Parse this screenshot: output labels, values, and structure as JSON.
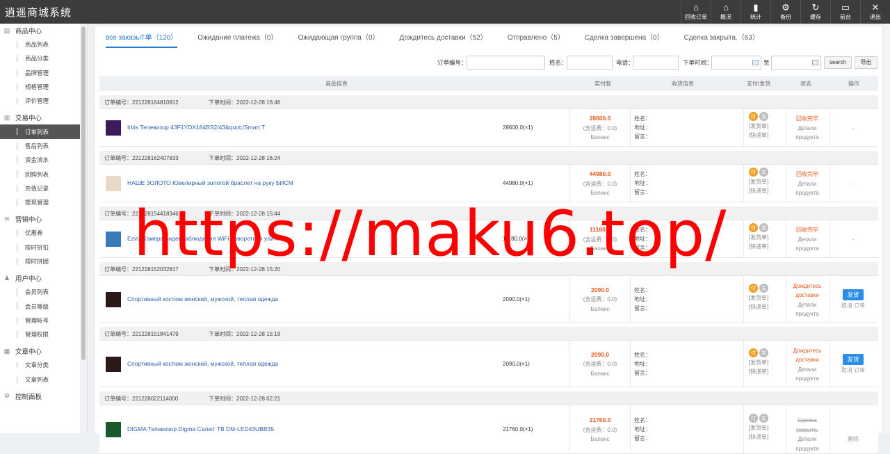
{
  "app": {
    "title": "逍遥商城系统"
  },
  "topnav": [
    {
      "label": "回收订单",
      "icon": "home-icon"
    },
    {
      "label": "概况",
      "icon": "home-icon"
    },
    {
      "label": "统计",
      "icon": "bar-chart-icon"
    },
    {
      "label": "备份",
      "icon": "gear-icon"
    },
    {
      "label": "缓存",
      "icon": "refresh-icon"
    },
    {
      "label": "前台",
      "icon": "monitor-icon"
    },
    {
      "label": "退出",
      "icon": "close-icon"
    }
  ],
  "sidebar": [
    {
      "title": "商品中心",
      "items": [
        "商品列表",
        "商品分类",
        "品牌管理",
        "规格管理",
        "评价管理"
      ]
    },
    {
      "title": "交易中心",
      "items": [
        "订单列表",
        "售后列表",
        "资金流水",
        "回购列表",
        "充值记录",
        "提现管理"
      ]
    },
    {
      "title": "营销中心",
      "items": [
        "优惠券",
        "限时折扣",
        "限时拼团"
      ]
    },
    {
      "title": "用户中心",
      "items": [
        "会员列表",
        "会员等级",
        "管理帐号",
        "管理权限"
      ]
    },
    {
      "title": "文章中心",
      "items": [
        "文章分类",
        "文章列表"
      ]
    },
    {
      "title": "控制面板",
      "items": []
    }
  ],
  "tabs": [
    "все заказыТ单（120）",
    "Ожидание платежа（0）",
    "Ожидающая группа（0）",
    "Дождитесь доставки（52）",
    "Отправлено（5）",
    "Сделка завершена（0）",
    "Сделка закрыта.（63）"
  ],
  "filters": {
    "order_no_label": "订单编号：",
    "name_label": "姓名：",
    "phone_label": "电话：",
    "time_label": "下单时间：",
    "to_label": "至",
    "search_label": "search",
    "export_label": "导出"
  },
  "table_header": {
    "product": "商品信息",
    "paid": "实付款",
    "receiver": "收货信息",
    "pay_ship": "支付/发货",
    "status": "状态",
    "action": "操作"
  },
  "labels": {
    "order_no": "订单编号：",
    "order_time": "下单时间：",
    "freight": "(含运费：0.0)",
    "balance": "Баланс",
    "recv_name": "姓名：",
    "recv_addr": "地址：",
    "recv_msg": "留言：",
    "pay_badge": "付",
    "ship_badge": "发",
    "ship_slip": "[发货单]",
    "express_slip": "[快递单]",
    "details": [
      "Детали",
      "продукта"
    ],
    "ship_button": "发货",
    "cancel": "取消 订单",
    "delete": "删除",
    "dash": "-"
  },
  "orders": [
    {
      "no": "221228164810912",
      "time": "2022-12-28 16:48",
      "product": "Irbis Телевизор 43F1YDX184BS2/43&quot;/Smart T",
      "qty": "28600.0(×1)",
      "amount": "28600.0",
      "status": "回收完毕",
      "state": "recycled",
      "thumb_color": "#3a1a5a"
    },
    {
      "no": "221228162407833",
      "time": "2022-12-28 16:24",
      "product": "НАШЕ ЗОЛОТО Ювелирный золотой браслет на руку БИСМ",
      "qty": "44980.0(×1)",
      "amount": "44980.0",
      "status": "回收完毕",
      "state": "recycled",
      "thumb_color": "#e8d8c8"
    },
    {
      "no": "221228154418346",
      "time": "2022-12-28 15:44",
      "product": "Ezviz Камера видеонаблюдения WiFi поворотная уличн",
      "qty": "11180.0(×1)",
      "amount": "11180.0",
      "status": "回收完毕",
      "state": "recycled",
      "thumb_color": "#3a7ab8"
    },
    {
      "no": "221228152032817",
      "time": "2022-12-28 15:20",
      "product": "Спортивный костюм женский, мужской, теплая одежда",
      "qty": "2090.0(×1)",
      "amount": "2090.0",
      "status": "Дождитесь доставки",
      "state": "waiting",
      "thumb_color": "#2a1a1a"
    },
    {
      "no": "221228151841479",
      "time": "2022-12-28 15:18",
      "product": "Спортивный костюм женский, мужской, теплая одежда",
      "qty": "2090.0(×1)",
      "amount": "2090.0",
      "status": "Дождитесь доставки",
      "state": "waiting",
      "thumb_color": "#2a1a1a"
    },
    {
      "no": "221228022114000",
      "time": "2022-12-28 02:21",
      "product": "DIGMA Телевизор Digma Салют ТВ DM-LED43UBB35",
      "qty": "21760.0(×1)",
      "amount": "21760.0",
      "status": "Сделка закрыта.",
      "state": "closed",
      "thumb_color": "#1a5a2a"
    }
  ],
  "watermark": "https://maku6.top/"
}
